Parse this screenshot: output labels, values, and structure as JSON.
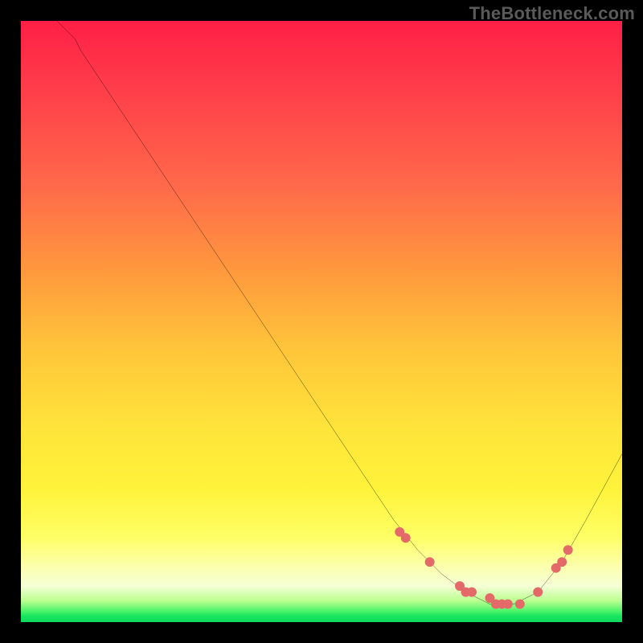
{
  "watermark": "TheBottleneck.com",
  "chart_data": {
    "type": "line",
    "title": "",
    "xlabel": "",
    "ylabel": "",
    "xlim": [
      0,
      100
    ],
    "ylim": [
      0,
      100
    ],
    "grid": false,
    "series": [
      {
        "name": "curve",
        "x": [
          6,
          9,
          10,
          16,
          24,
          36,
          48,
          58,
          62,
          66,
          70,
          74,
          78,
          82,
          86,
          90,
          94,
          100
        ],
        "y": [
          100,
          97,
          95,
          86,
          74,
          56,
          38,
          23,
          17,
          12,
          8,
          5,
          3,
          3,
          5,
          10,
          17,
          28
        ],
        "stroke": "#000000",
        "stroke_width": 2
      }
    ],
    "markers": {
      "name": "highlight-points",
      "color": "#e46a6a",
      "radius": 5,
      "points": [
        {
          "x": 63,
          "y": 15
        },
        {
          "x": 64,
          "y": 14
        },
        {
          "x": 68,
          "y": 10
        },
        {
          "x": 73,
          "y": 6
        },
        {
          "x": 74,
          "y": 5
        },
        {
          "x": 75,
          "y": 5
        },
        {
          "x": 78,
          "y": 4
        },
        {
          "x": 79,
          "y": 3
        },
        {
          "x": 80,
          "y": 3
        },
        {
          "x": 81,
          "y": 3
        },
        {
          "x": 83,
          "y": 3
        },
        {
          "x": 86,
          "y": 5
        },
        {
          "x": 89,
          "y": 9
        },
        {
          "x": 90,
          "y": 10
        },
        {
          "x": 91,
          "y": 12
        }
      ]
    },
    "gradient_stops": [
      {
        "pos": 0.0,
        "color": "#ff1f46"
      },
      {
        "pos": 0.28,
        "color": "#ff6b4a"
      },
      {
        "pos": 0.55,
        "color": "#ffc63a"
      },
      {
        "pos": 0.78,
        "color": "#fff33b"
      },
      {
        "pos": 0.94,
        "color": "#f5ffd6"
      },
      {
        "pos": 1.0,
        "color": "#10d95a"
      }
    ]
  }
}
